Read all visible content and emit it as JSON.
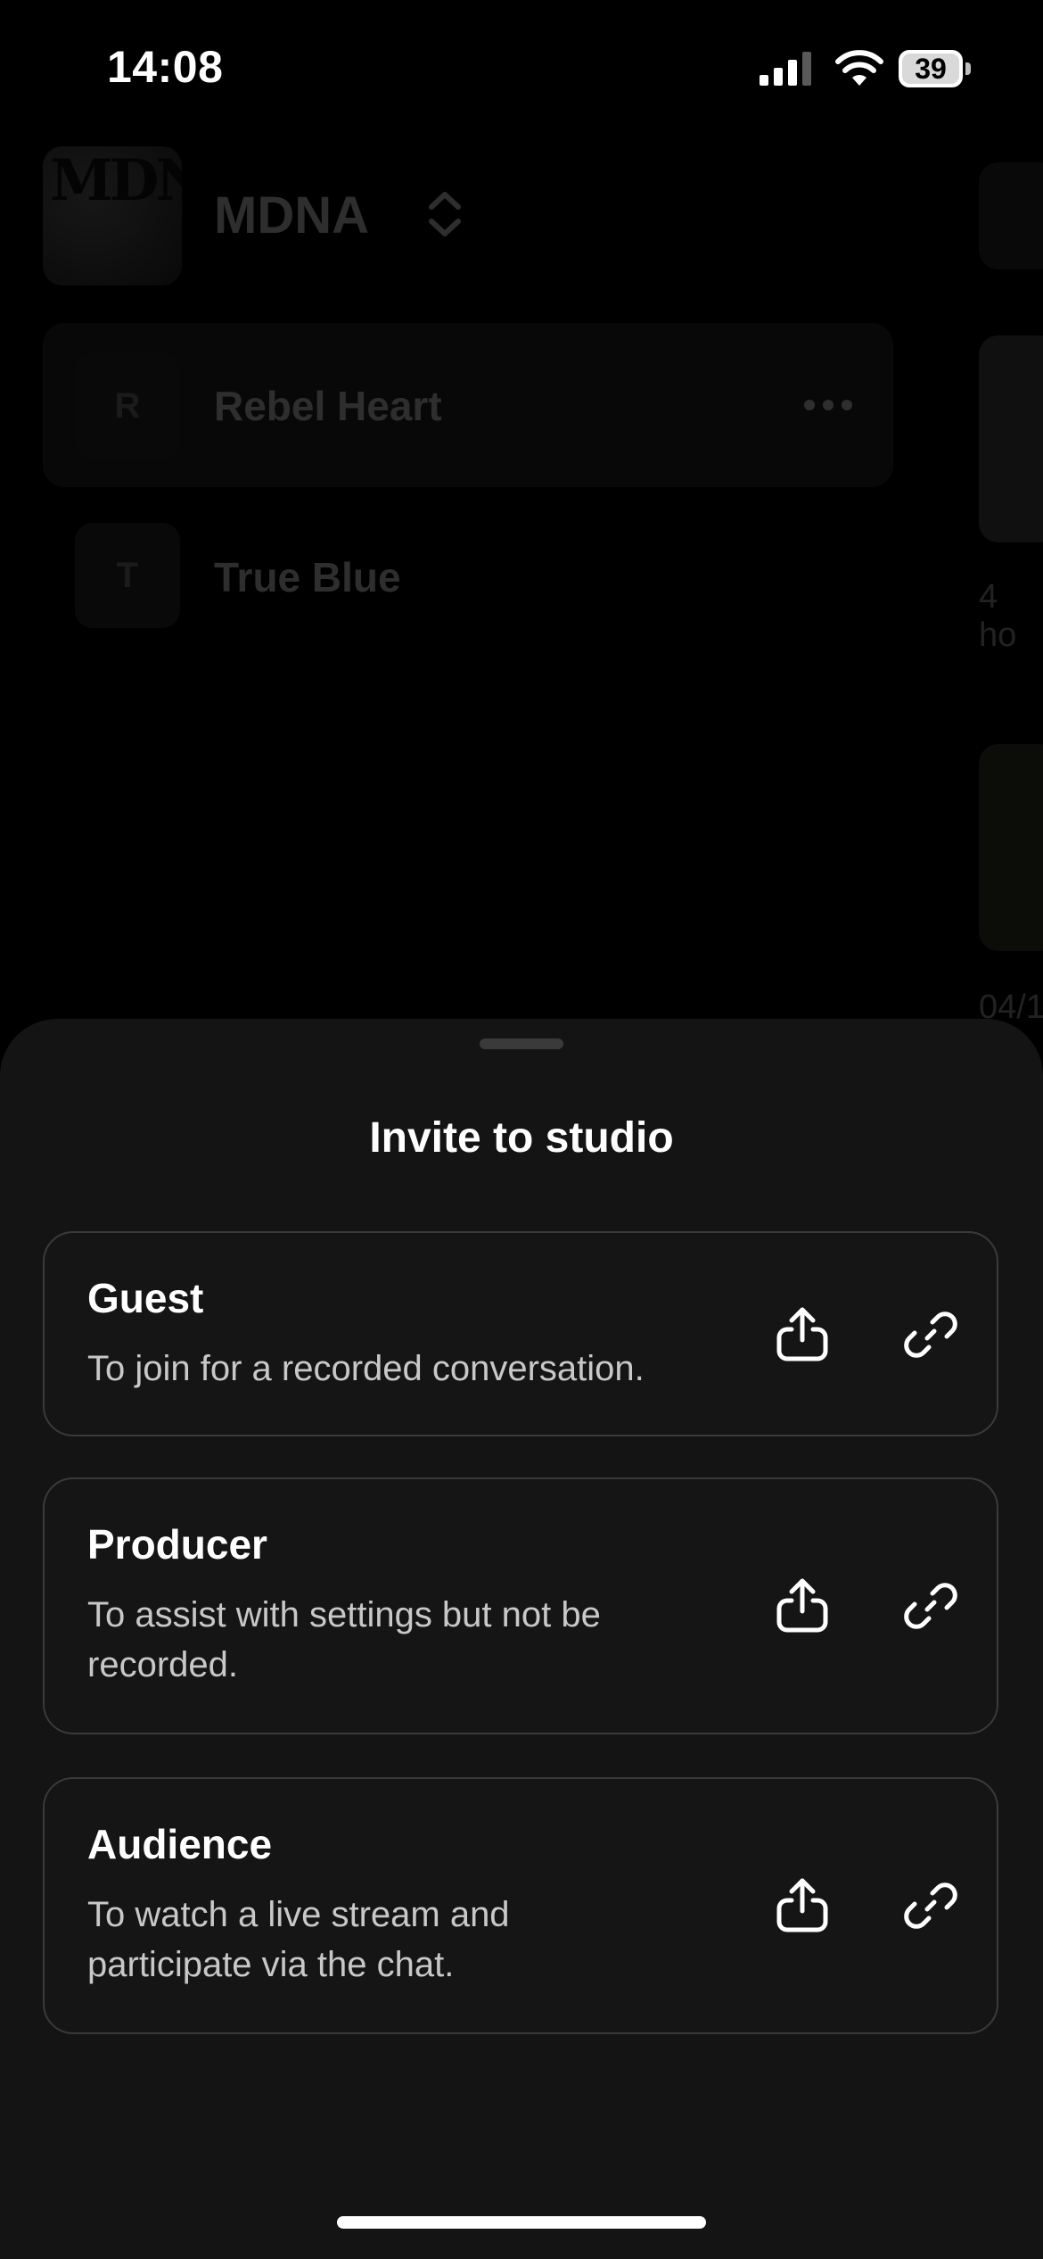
{
  "status_bar": {
    "time": "14:08",
    "battery_level": "39"
  },
  "background": {
    "workspace": {
      "logo_text": "MDNA",
      "name": "MDNA"
    },
    "projects": [
      {
        "initial": "R",
        "name": "Rebel Heart"
      },
      {
        "initial": "T",
        "name": "True Blue"
      }
    ],
    "right_peek": [
      "4 ho",
      "04/1"
    ]
  },
  "sheet": {
    "title": "Invite to studio",
    "options": [
      {
        "title": "Guest",
        "description": "To join for a recorded conversation."
      },
      {
        "title": "Producer",
        "description": "To assist with settings but not be recorded."
      },
      {
        "title": "Audience",
        "description": "To watch a live stream and participate via the chat."
      }
    ]
  },
  "icons": {
    "share": "share-upload-icon",
    "link": "link-icon",
    "more": "more-horizontal-icon",
    "switcher": "chevron-up-down-icon"
  }
}
